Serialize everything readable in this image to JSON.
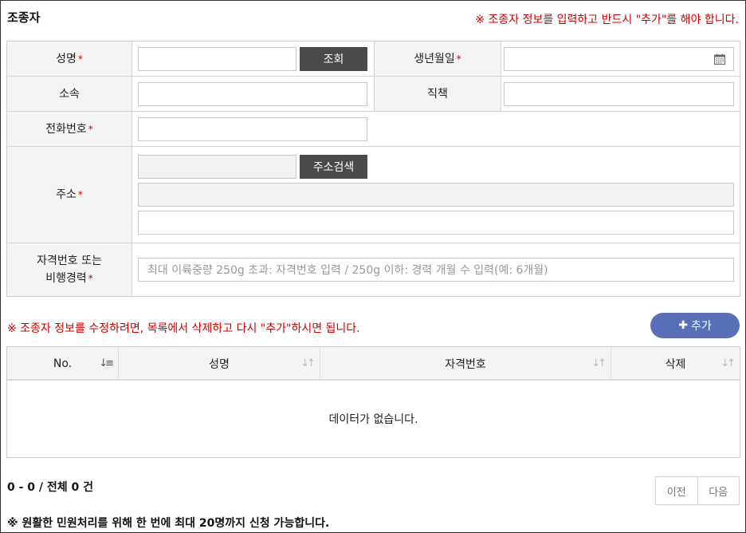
{
  "section": {
    "title": "조종자",
    "notice": "※ 조종자 정보를 입력하고 반드시 \"추가\"를 해야 합니다."
  },
  "form": {
    "required_mark": "*",
    "name_label": "성명",
    "lookup_button": "조회",
    "birth_label": "생년월일",
    "affiliation_label": "소속",
    "position_label": "직책",
    "phone_label": "전화번호",
    "address_label": "주소",
    "address_search_button": "주소검색",
    "license_label_line1": "자격번호 또는",
    "license_label_line2": "비행경력",
    "license_placeholder": "최대 이륙중량 250g 초과: 자격번호 입력 / 250g 이하: 경력 개월 수 입력(예: 6개월)",
    "calendar_icon": "calendar-icon"
  },
  "list": {
    "notice": "※ 조종자 정보를 수정하려면, 목록에서 삭제하고 다시 \"추가\"하시면 됩니다.",
    "add_button": "추가",
    "columns": [
      "No.",
      "성명",
      "자격번호",
      "삭제"
    ],
    "empty_text": "데이터가 없습니다."
  },
  "pagination": {
    "count_text": "0 - 0 / 전체 0 건",
    "prev": "이전",
    "next": "다음"
  },
  "footer": {
    "note": "※ 원활한 민원처리를 위해 한 번에 최대 20명까지 신청 가능합니다."
  },
  "colors": {
    "required": "#cc0000",
    "accent_button": "#5870b8",
    "dark_button": "#4a4a4a"
  }
}
